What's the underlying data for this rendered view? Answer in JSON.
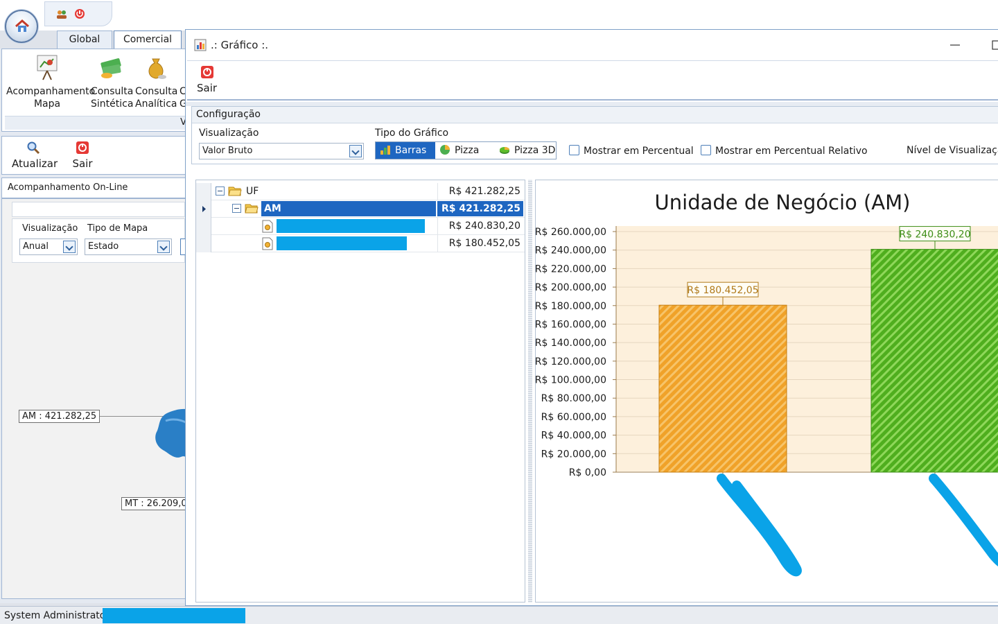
{
  "ribbon": {
    "tabs": [
      "Global",
      "Comercial"
    ],
    "buttons": [
      {
        "label1": "Acompanhamento",
        "label2": "Mapa",
        "icon": "presentation-board-icon"
      },
      {
        "label1": "Consulta",
        "label2": "Sintética",
        "icon": "money-stack-icon"
      },
      {
        "label1": "Consulta",
        "label2": "Analítica",
        "icon": "money-bag-icon"
      },
      {
        "label1": "C",
        "label2": "G",
        "icon": "truncated-icon"
      }
    ],
    "group_fragment": "V"
  },
  "left_toolbar": {
    "refresh": "Atualizar",
    "exit": "Sair"
  },
  "online": {
    "title": "Acompanhamento On-Line",
    "visualizacao_label": "Visualização",
    "visualizacao_value": "Anual",
    "tipo_mapa_label": "Tipo de Mapa",
    "tipo_mapa_value": "Estado",
    "map_labels": [
      "AM : 421.282,25",
      "MT : 26.209,0"
    ]
  },
  "graph_window": {
    "title": ".: Gráfico :.",
    "exit_label": "Sair",
    "config_title": "Configuração",
    "visualizacao_label": "Visualização",
    "visualizacao_value": "Valor Bruto",
    "tipo_label": "Tipo do Gráfico",
    "chart_types": [
      "Barras",
      "Pizza",
      "Pizza 3D"
    ],
    "selected_type": "Barras",
    "checkbox_percent": "Mostrar em Percentual",
    "checkbox_percent_rel": "Mostrar em Percentual Relativo",
    "nivel_label": "Nível de Visualização"
  },
  "tree": {
    "rows": [
      {
        "name": "UF",
        "value": "R$ 421.282,25",
        "level": 0,
        "selected": false,
        "redacted": false
      },
      {
        "name": "AM",
        "value": "R$ 421.282,25",
        "level": 1,
        "selected": true,
        "redacted": false
      },
      {
        "name": "",
        "value": "R$ 240.830,20",
        "level": 2,
        "selected": false,
        "redacted": true
      },
      {
        "name": "",
        "value": "R$ 180.452,05",
        "level": 2,
        "selected": false,
        "redacted": true
      }
    ]
  },
  "status": {
    "user": "System Administrator /"
  },
  "colors": {
    "accent": "#1e66c1",
    "redaction": "#0aa3e8",
    "bar_orange": "#f0a229",
    "bar_green": "#5fbd2a"
  },
  "chart_data": {
    "type": "bar",
    "title": "Unidade de Negócio (AM)",
    "categories": [
      "",
      ""
    ],
    "values": [
      180452.05,
      240830.2
    ],
    "data_labels": [
      "R$ 180.452,05",
      "R$ 240.830,20"
    ],
    "ylim": [
      0,
      260000
    ],
    "y_ticks": [
      "R$ 0,00",
      "R$ 20.000,00",
      "R$ 40.000,00",
      "R$ 60.000,00",
      "R$ 80.000,00",
      "R$ 100.000,00",
      "R$ 120.000,00",
      "R$ 140.000,00",
      "R$ 160.000,00",
      "R$ 180.000,00",
      "R$ 200.000,00",
      "R$ 220.000,00",
      "R$ 240.000,00",
      "R$ 260.000,00"
    ],
    "grid": true,
    "legend": "none"
  }
}
